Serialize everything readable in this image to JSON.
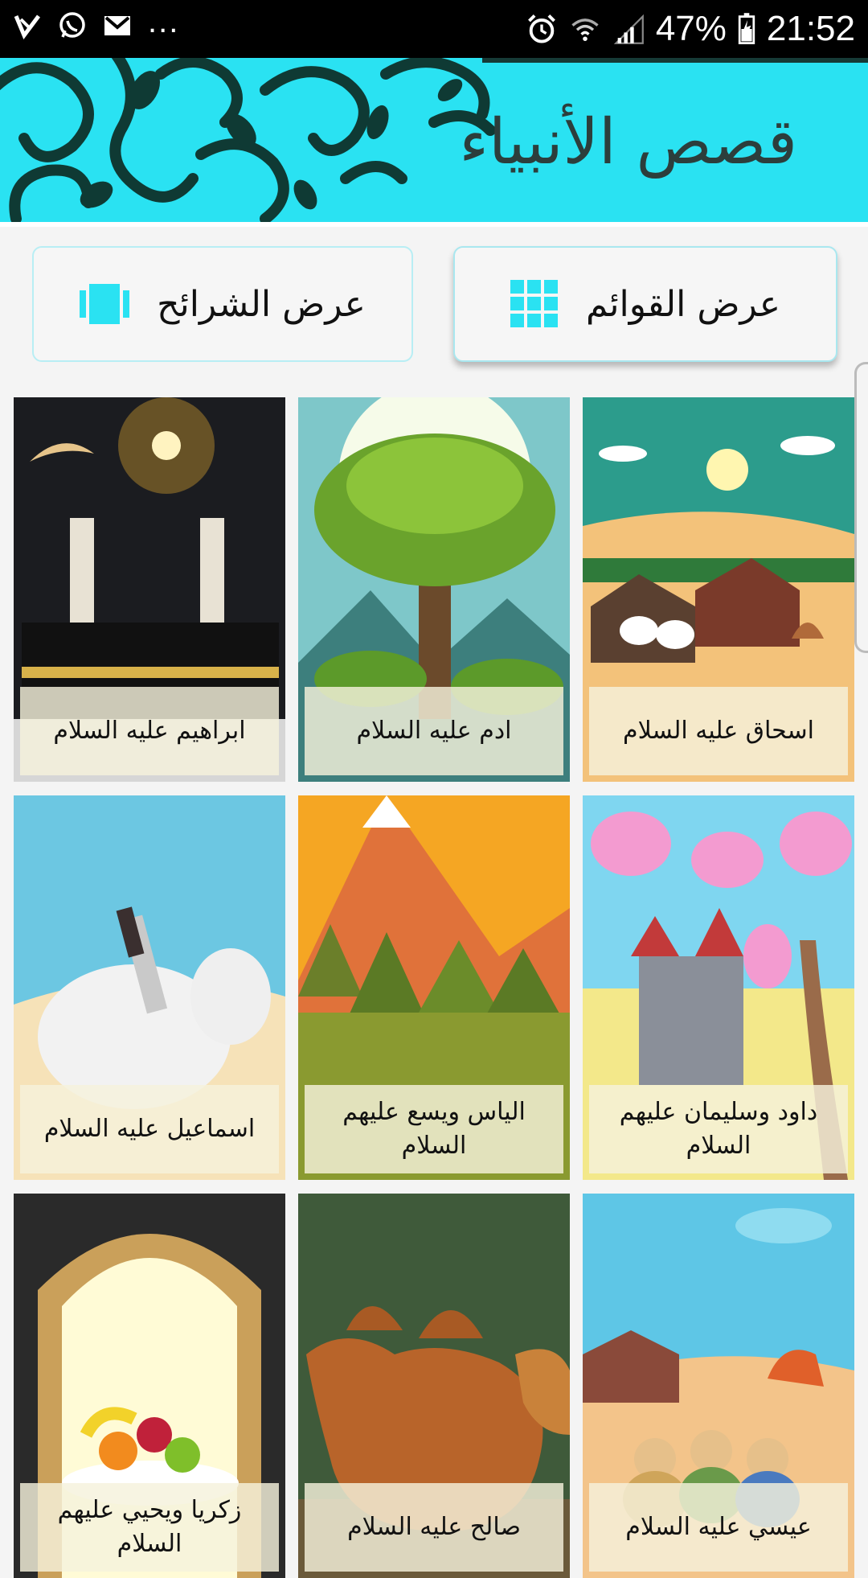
{
  "status_bar": {
    "battery": "47%",
    "time": "21:52",
    "overflow_dots": "..."
  },
  "header": {
    "title": "قصص الأنبياء"
  },
  "view_buttons": {
    "list_view": "عرض القوائم",
    "slides_view": "عرض الشرائح"
  },
  "stories": [
    {
      "title": "ابراهيم عليه السلام"
    },
    {
      "title": "ادم عليه السلام"
    },
    {
      "title": "اسحاق عليه السلام"
    },
    {
      "title": "اسماعيل عليه السلام"
    },
    {
      "title": "الياس ويسع عليهم السلام"
    },
    {
      "title": "داود وسليمان عليهم السلام"
    },
    {
      "title": "زكريا ويحيي عليهم السلام"
    },
    {
      "title": "صالح عليه السلام"
    },
    {
      "title": "عيسي عليه السلام"
    }
  ],
  "colors": {
    "accent_cyan": "#2ae2f2",
    "status_bar": "#000000"
  }
}
